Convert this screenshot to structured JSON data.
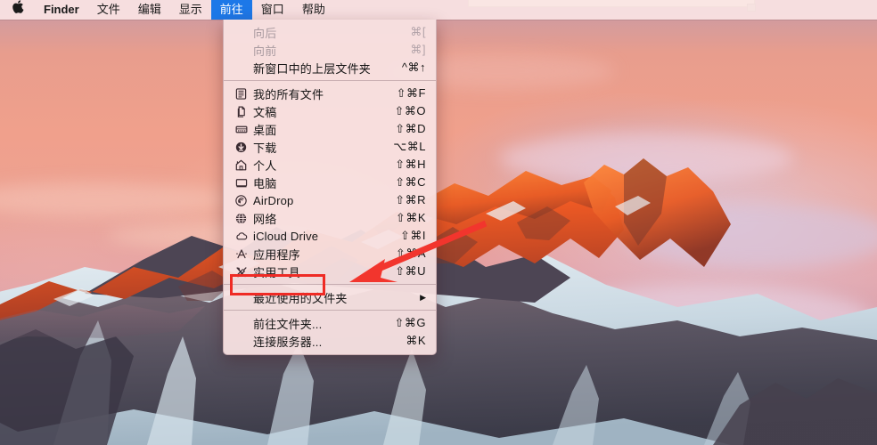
{
  "menubar": {
    "apple_icon": "apple-logo",
    "items": [
      {
        "label": "Finder",
        "bold": true,
        "active": false
      },
      {
        "label": "文件",
        "bold": false,
        "active": false
      },
      {
        "label": "编辑",
        "bold": false,
        "active": false
      },
      {
        "label": "显示",
        "bold": false,
        "active": false
      },
      {
        "label": "前往",
        "bold": false,
        "active": true
      },
      {
        "label": "窗口",
        "bold": false,
        "active": false
      },
      {
        "label": "帮助",
        "bold": false,
        "active": false
      }
    ]
  },
  "go_menu": {
    "title": "前往",
    "items": [
      {
        "label": "向后",
        "shortcut": "⌘[",
        "icon": null,
        "disabled": true,
        "submenu": false
      },
      {
        "label": "向前",
        "shortcut": "⌘]",
        "icon": null,
        "disabled": true,
        "submenu": false
      },
      {
        "label": "新窗口中的上层文件夹",
        "shortcut": "^⌘↑",
        "icon": null,
        "disabled": false,
        "submenu": false
      },
      {
        "separator": true
      },
      {
        "label": "我的所有文件",
        "shortcut": "⇧⌘F",
        "icon": "all-files-icon",
        "disabled": false,
        "submenu": false
      },
      {
        "label": "文稿",
        "shortcut": "⇧⌘O",
        "icon": "documents-icon",
        "disabled": false,
        "submenu": false
      },
      {
        "label": "桌面",
        "shortcut": "⇧⌘D",
        "icon": "desktop-icon",
        "disabled": false,
        "submenu": false
      },
      {
        "label": "下载",
        "shortcut": "⌥⌘L",
        "icon": "downloads-icon",
        "disabled": false,
        "submenu": false
      },
      {
        "label": "个人",
        "shortcut": "⇧⌘H",
        "icon": "home-icon",
        "disabled": false,
        "submenu": false
      },
      {
        "label": "电脑",
        "shortcut": "⇧⌘C",
        "icon": "computer-icon",
        "disabled": false,
        "submenu": false
      },
      {
        "label": "AirDrop",
        "shortcut": "⇧⌘R",
        "icon": "airdrop-icon",
        "disabled": false,
        "submenu": false
      },
      {
        "label": "网络",
        "shortcut": "⇧⌘K",
        "icon": "network-icon",
        "disabled": false,
        "submenu": false
      },
      {
        "label": "iCloud Drive",
        "shortcut": "⇧⌘I",
        "icon": "icloud-icon",
        "disabled": false,
        "submenu": false
      },
      {
        "label": "应用程序",
        "shortcut": "⇧⌘A",
        "icon": "applications-icon",
        "disabled": false,
        "submenu": false
      },
      {
        "label": "实用工具",
        "shortcut": "⇧⌘U",
        "icon": "utilities-icon",
        "disabled": false,
        "submenu": false,
        "highlighted": true
      },
      {
        "separator": true
      },
      {
        "label": "最近使用的文件夹",
        "shortcut": "",
        "icon": null,
        "disabled": false,
        "submenu": true
      },
      {
        "separator": true
      },
      {
        "label": "前往文件夹...",
        "shortcut": "⇧⌘G",
        "icon": null,
        "disabled": false,
        "submenu": false
      },
      {
        "label": "连接服务器...",
        "shortcut": "⌘K",
        "icon": null,
        "disabled": false,
        "submenu": false
      }
    ]
  },
  "annotations": {
    "highlight_color": "#ef2b25",
    "arrow_color": "#f2352d",
    "highlight_target": "实用工具",
    "arrow_from": "545,252",
    "arrow_to": "392,316"
  },
  "desktop": {
    "wallpaper_name": "macos-sierra-mountain-sunset"
  }
}
